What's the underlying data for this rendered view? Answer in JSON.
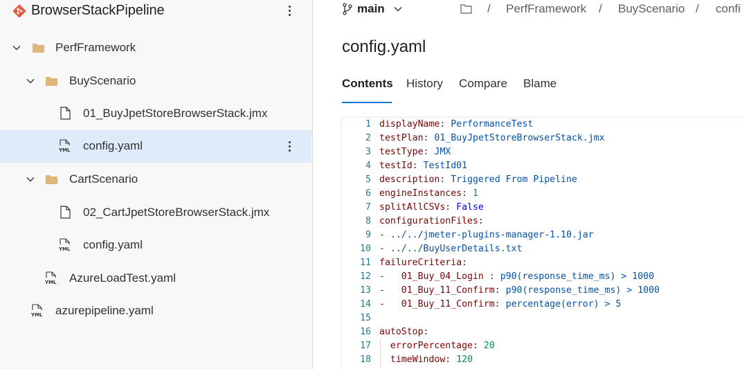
{
  "sidebar": {
    "repo_name": "BrowserStackPipeline",
    "tree": [
      {
        "label": "PerfFramework",
        "type": "folder",
        "expanded": true,
        "depth": 0
      },
      {
        "label": "BuyScenario",
        "type": "folder",
        "expanded": true,
        "depth": 1
      },
      {
        "label": "01_BuyJpetStoreBrowserStack.jmx",
        "type": "file",
        "depth": 2
      },
      {
        "label": "config.yaml",
        "type": "yaml",
        "depth": 2,
        "selected": true
      },
      {
        "label": "CartScenario",
        "type": "folder",
        "expanded": true,
        "depth": 1
      },
      {
        "label": "02_CartJpetStoreBrowserStack.jmx",
        "type": "file",
        "depth": 2
      },
      {
        "label": "config.yaml",
        "type": "yaml",
        "depth": 2
      },
      {
        "label": "AzureLoadTest.yaml",
        "type": "yaml",
        "depth": 1
      },
      {
        "label": "azurepipeline.yaml",
        "type": "yaml",
        "depth": 0
      }
    ],
    "yaml_icon_text": "YML"
  },
  "header": {
    "branch": "main",
    "breadcrumb": [
      "PerfFramework",
      "BuyScenario",
      "confi"
    ],
    "separator": "/"
  },
  "file": {
    "title": "config.yaml",
    "tabs": [
      "Contents",
      "History",
      "Compare",
      "Blame"
    ],
    "active_tab": "Contents"
  },
  "code": {
    "lines": [
      {
        "n": "1",
        "t": [
          [
            "k",
            "displayName"
          ],
          [
            "p",
            ": "
          ],
          [
            "v",
            "PerformanceTest"
          ]
        ]
      },
      {
        "n": "2",
        "t": [
          [
            "k",
            "testPlan"
          ],
          [
            "p",
            ": "
          ],
          [
            "v",
            "01_BuyJpetStoreBrowserStack.jmx"
          ]
        ]
      },
      {
        "n": "3",
        "t": [
          [
            "k",
            "testType"
          ],
          [
            "p",
            ": "
          ],
          [
            "v",
            "JMX"
          ]
        ]
      },
      {
        "n": "4",
        "t": [
          [
            "k",
            "testId"
          ],
          [
            "p",
            ": "
          ],
          [
            "v",
            "TestId01"
          ]
        ]
      },
      {
        "n": "5",
        "t": [
          [
            "k",
            "description"
          ],
          [
            "p",
            ": "
          ],
          [
            "v",
            "Triggered From Pipeline"
          ]
        ]
      },
      {
        "n": "6",
        "t": [
          [
            "k",
            "engineInstances"
          ],
          [
            "p",
            ": "
          ],
          [
            "n",
            "1"
          ]
        ]
      },
      {
        "n": "7",
        "t": [
          [
            "k",
            "splitAllCSVs"
          ],
          [
            "p",
            ": "
          ],
          [
            "b",
            "False"
          ]
        ]
      },
      {
        "n": "8",
        "t": [
          [
            "k",
            "configurationFiles"
          ],
          [
            "p",
            ":"
          ]
        ]
      },
      {
        "n": "9",
        "t": [
          [
            "p",
            "- "
          ],
          [
            "v",
            "../../jmeter-plugins-manager-1.10.jar"
          ]
        ]
      },
      {
        "n": "10",
        "t": [
          [
            "p",
            "- "
          ],
          [
            "v",
            "../../BuyUserDetails.txt"
          ]
        ]
      },
      {
        "n": "11",
        "t": [
          [
            "k",
            "failureCriteria"
          ],
          [
            "p",
            ":"
          ]
        ]
      },
      {
        "n": "12",
        "t": [
          [
            "p",
            "-   "
          ],
          [
            "k",
            "01_Buy_04_Login "
          ],
          [
            "p",
            ": "
          ],
          [
            "v",
            "p90(response_time_ms) > 1000"
          ]
        ]
      },
      {
        "n": "13",
        "t": [
          [
            "p",
            "-   "
          ],
          [
            "k",
            "01_Buy_11_Confirm"
          ],
          [
            "p",
            ": "
          ],
          [
            "v",
            "p90(response_time_ms) > 1000"
          ]
        ]
      },
      {
        "n": "14",
        "t": [
          [
            "p",
            "-   "
          ],
          [
            "k",
            "01_Buy_11_Confirm"
          ],
          [
            "p",
            ": "
          ],
          [
            "v",
            "percentage(error) > 5"
          ]
        ]
      },
      {
        "n": "15",
        "t": []
      },
      {
        "n": "16",
        "t": [
          [
            "k",
            "autoStop"
          ],
          [
            "p",
            ":"
          ]
        ]
      },
      {
        "n": "17",
        "t": [
          [
            "p",
            "  "
          ],
          [
            "k",
            "errorPercentage"
          ],
          [
            "p",
            ": "
          ],
          [
            "n",
            "20"
          ]
        ]
      },
      {
        "n": "18",
        "t": [
          [
            "p",
            "  "
          ],
          [
            "k",
            "timeWindow"
          ],
          [
            "p",
            ": "
          ],
          [
            "n",
            "120"
          ]
        ]
      }
    ]
  },
  "colors": {
    "accent": "#0078d4",
    "selected_row": "#deecf9",
    "folder": "#dcb67a",
    "repo_logo": "#e05d44"
  }
}
